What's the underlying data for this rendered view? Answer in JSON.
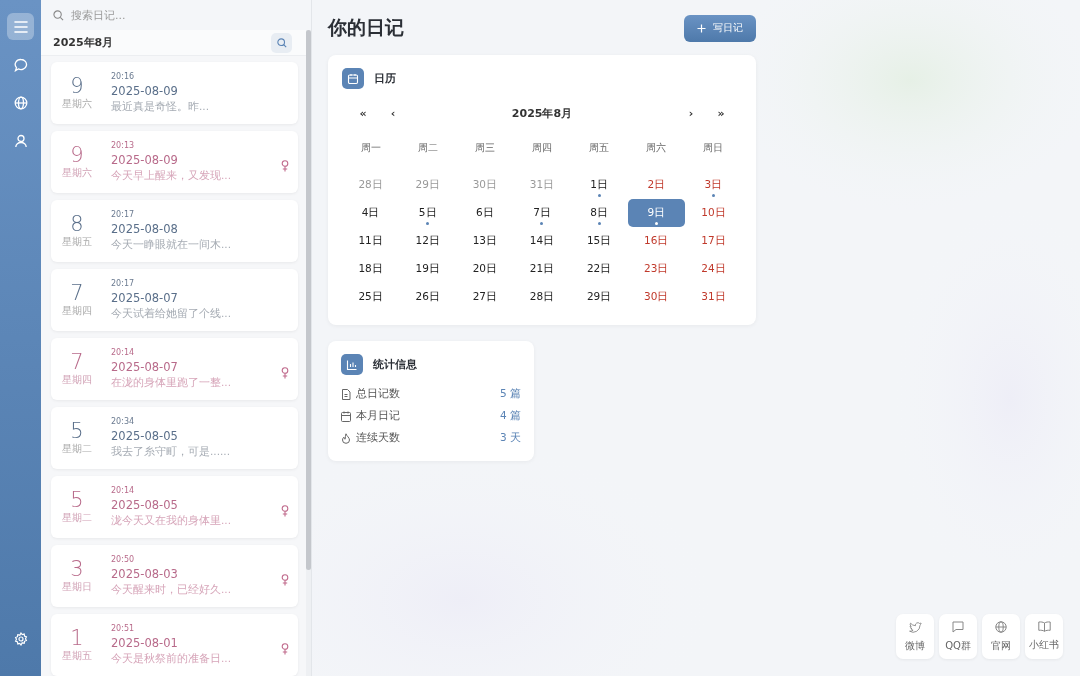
{
  "search": {
    "placeholder": "搜索日记..."
  },
  "list_header": {
    "month": "2025年8月"
  },
  "entries": [
    {
      "day": "9",
      "weekday": "星期六",
      "time": "20:16",
      "date": "2025-08-09",
      "excerpt": "最近真是奇怪。昨...",
      "kind": "plain"
    },
    {
      "day": "9",
      "weekday": "星期六",
      "time": "20:13",
      "date": "2025-08-09",
      "excerpt": "今天早上醒来，又发现...",
      "kind": "female"
    },
    {
      "day": "8",
      "weekday": "星期五",
      "time": "20:17",
      "date": "2025-08-08",
      "excerpt": "今天一睁眼就在一间木...",
      "kind": "plain"
    },
    {
      "day": "7",
      "weekday": "星期四",
      "time": "20:17",
      "date": "2025-08-07",
      "excerpt": "今天试着给她留了个线...",
      "kind": "plain"
    },
    {
      "day": "7",
      "weekday": "星期四",
      "time": "20:14",
      "date": "2025-08-07",
      "excerpt": "在泷的身体里跑了一整...",
      "kind": "female"
    },
    {
      "day": "5",
      "weekday": "星期二",
      "time": "20:34",
      "date": "2025-08-05",
      "excerpt": "我去了糸守町，可是......",
      "kind": "plain"
    },
    {
      "day": "5",
      "weekday": "星期二",
      "time": "20:14",
      "date": "2025-08-05",
      "excerpt": "泷今天又在我的身体里...",
      "kind": "female"
    },
    {
      "day": "3",
      "weekday": "星期日",
      "time": "20:50",
      "date": "2025-08-03",
      "excerpt": "今天醒来时，已经好久...",
      "kind": "female"
    },
    {
      "day": "1",
      "weekday": "星期五",
      "time": "20:51",
      "date": "2025-08-01",
      "excerpt": "今天是秋祭前的准备日...",
      "kind": "female"
    }
  ],
  "page_title": "你的日记",
  "write_button": {
    "label": "写日记"
  },
  "calendar": {
    "title": "日历",
    "month": "2025年8月",
    "nav": [
      "«",
      "‹",
      "›",
      "»"
    ],
    "weekdays": [
      "周一",
      "周二",
      "周三",
      "周四",
      "周五",
      "周六",
      "周日"
    ],
    "days": [
      {
        "label": "28日",
        "kind": "other",
        "has_entry": false,
        "selected": false
      },
      {
        "label": "29日",
        "kind": "other",
        "has_entry": false,
        "selected": false
      },
      {
        "label": "30日",
        "kind": "other",
        "has_entry": false,
        "selected": false
      },
      {
        "label": "31日",
        "kind": "other",
        "has_entry": false,
        "selected": false
      },
      {
        "label": "1日",
        "kind": "weekday",
        "has_entry": true,
        "selected": false
      },
      {
        "label": "2日",
        "kind": "weekend",
        "has_entry": false,
        "selected": false
      },
      {
        "label": "3日",
        "kind": "weekend",
        "has_entry": true,
        "selected": false
      },
      {
        "label": "4日",
        "kind": "weekday",
        "has_entry": false,
        "selected": false
      },
      {
        "label": "5日",
        "kind": "weekday",
        "has_entry": true,
        "selected": false
      },
      {
        "label": "6日",
        "kind": "weekday",
        "has_entry": false,
        "selected": false
      },
      {
        "label": "7日",
        "kind": "weekday",
        "has_entry": true,
        "selected": false
      },
      {
        "label": "8日",
        "kind": "weekday",
        "has_entry": true,
        "selected": false
      },
      {
        "label": "9日",
        "kind": "weekend",
        "has_entry": true,
        "selected": true
      },
      {
        "label": "10日",
        "kind": "weekend",
        "has_entry": false,
        "selected": false
      },
      {
        "label": "11日",
        "kind": "weekday",
        "has_entry": false,
        "selected": false
      },
      {
        "label": "12日",
        "kind": "weekday",
        "has_entry": false,
        "selected": false
      },
      {
        "label": "13日",
        "kind": "weekday",
        "has_entry": false,
        "selected": false
      },
      {
        "label": "14日",
        "kind": "weekday",
        "has_entry": false,
        "selected": false
      },
      {
        "label": "15日",
        "kind": "weekday",
        "has_entry": false,
        "selected": false
      },
      {
        "label": "16日",
        "kind": "weekend",
        "has_entry": false,
        "selected": false
      },
      {
        "label": "17日",
        "kind": "weekend",
        "has_entry": false,
        "selected": false
      },
      {
        "label": "18日",
        "kind": "weekday",
        "has_entry": false,
        "selected": false
      },
      {
        "label": "19日",
        "kind": "weekday",
        "has_entry": false,
        "selected": false
      },
      {
        "label": "20日",
        "kind": "weekday",
        "has_entry": false,
        "selected": false
      },
      {
        "label": "21日",
        "kind": "weekday",
        "has_entry": false,
        "selected": false
      },
      {
        "label": "22日",
        "kind": "weekday",
        "has_entry": false,
        "selected": false
      },
      {
        "label": "23日",
        "kind": "weekend",
        "has_entry": false,
        "selected": false
      },
      {
        "label": "24日",
        "kind": "weekend",
        "has_entry": false,
        "selected": false
      },
      {
        "label": "25日",
        "kind": "weekday",
        "has_entry": false,
        "selected": false
      },
      {
        "label": "26日",
        "kind": "weekday",
        "has_entry": false,
        "selected": false
      },
      {
        "label": "27日",
        "kind": "weekday",
        "has_entry": false,
        "selected": false
      },
      {
        "label": "28日",
        "kind": "weekday",
        "has_entry": false,
        "selected": false
      },
      {
        "label": "29日",
        "kind": "weekday",
        "has_entry": false,
        "selected": false
      },
      {
        "label": "30日",
        "kind": "weekend",
        "has_entry": false,
        "selected": false
      },
      {
        "label": "31日",
        "kind": "weekend",
        "has_entry": false,
        "selected": false
      }
    ]
  },
  "stats": {
    "title": "统计信息",
    "rows": [
      {
        "label": "总日记数",
        "value": "5 篇",
        "kind": "document"
      },
      {
        "label": "本月日记",
        "value": "4 篇",
        "kind": "calendar"
      },
      {
        "label": "连续天数",
        "value": "3 天",
        "kind": "flame"
      }
    ]
  },
  "links": [
    {
      "label": "微博",
      "kind": "bird"
    },
    {
      "label": "QQ群",
      "kind": "chat"
    },
    {
      "label": "官网",
      "kind": "globe"
    },
    {
      "label": "小红书",
      "kind": "book"
    }
  ]
}
